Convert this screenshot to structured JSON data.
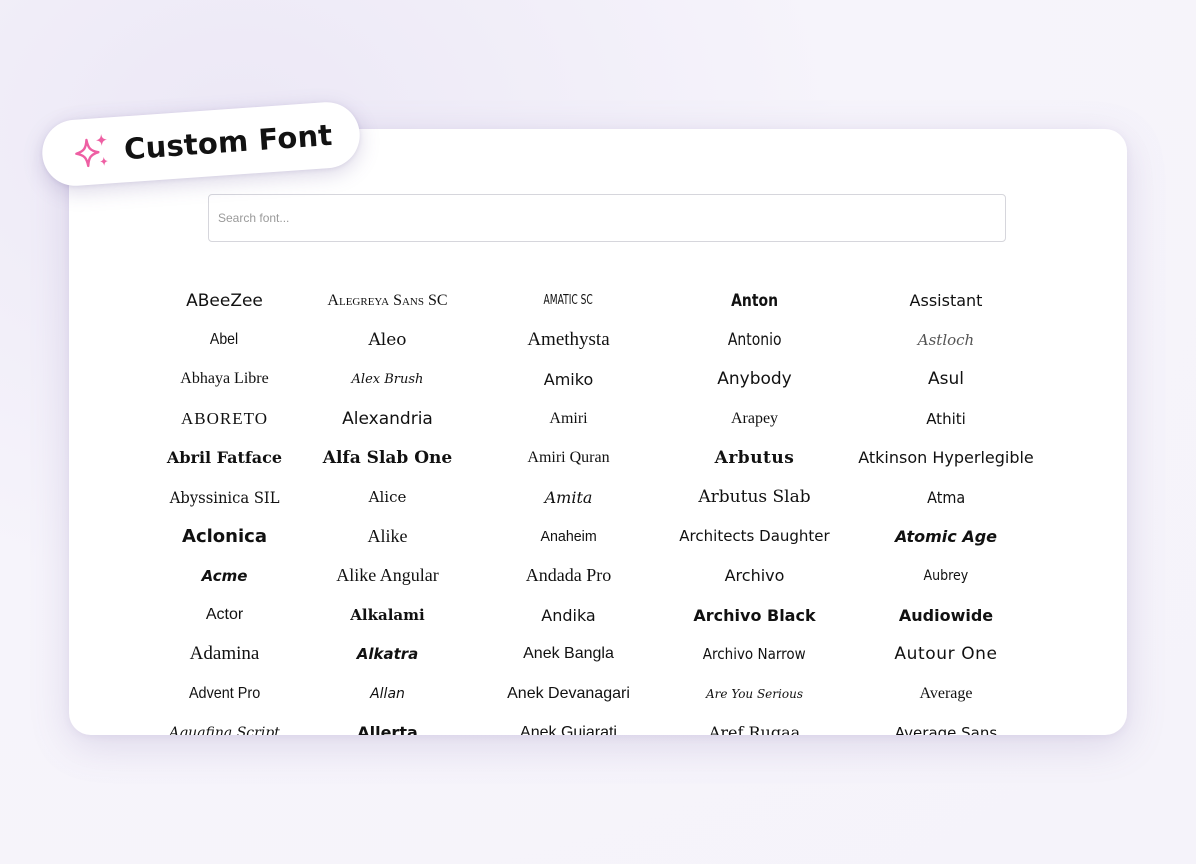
{
  "badge": {
    "title": "Custom Font",
    "icon": "sparkles-icon",
    "icon_color": "#ee5fa3"
  },
  "search": {
    "placeholder": "Search font...",
    "value": ""
  },
  "fonts": {
    "columns": [
      [
        "ABeeZee",
        "Abel",
        "Abhaya Libre",
        "ABORETO",
        "Abril Fatface",
        "Abyssinica SIL",
        "Aclonica",
        "Acme",
        "Actor",
        "Adamina",
        "Advent Pro",
        "Aguafina Script"
      ],
      [
        "Alegreya Sans SC",
        "Aleo",
        "Alex Brush",
        "Alexandria",
        "Alfa Slab One",
        "Alice",
        "Alike",
        "Alike Angular",
        "Alkalami",
        "Alkatra",
        "Allan",
        "Allerta"
      ],
      [
        "AMATIC SC",
        "Amethysta",
        "Amiko",
        "Amiri",
        "Amiri Quran",
        "Amita",
        "Anaheim",
        "Andada Pro",
        "Andika",
        "Anek Bangla",
        "Anek Devanagari",
        "Anek Gujarati"
      ],
      [
        "Anton",
        "Antonio",
        "Anybody",
        "Arapey",
        "Arbutus",
        "Arbutus Slab",
        "Architects Daughter",
        "Archivo",
        "Archivo Black",
        "Archivo Narrow",
        "Are You Serious",
        "Aref Ruqaa"
      ],
      [
        "Assistant",
        "Astloch",
        "Asul",
        "Athiti",
        "Atkinson Hyperlegible",
        "Atma",
        "Atomic Age",
        "Aubrey",
        "Audiowide",
        "Autour One",
        "Average",
        "Average Sans"
      ]
    ]
  }
}
